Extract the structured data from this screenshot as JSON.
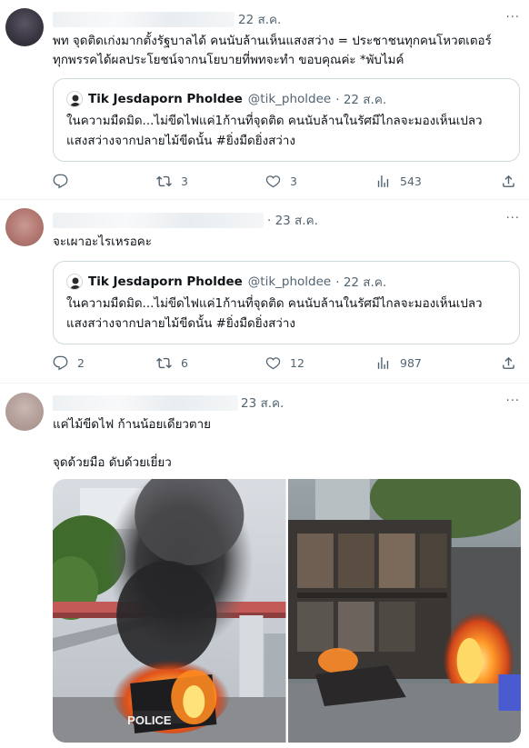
{
  "tweets": [
    {
      "date": "22 ส.ค.",
      "text": "พท จุดติดเก่งมากตั้งรัฐบาลได้ คนนับล้านเห็นแสงสว่าง = ประชาชนทุกคนโหวตเตอร์\nทุกพรรคได้ผลประโยชน์จากนโยบายที่พทจะทำ ขอบคุณค่ะ *พับไมค์",
      "quote": {
        "name": "Tik Jesdaporn Pholdee",
        "handle": "@tik_pholdee",
        "date": "· 22 ส.ค.",
        "text": "ในความมืดมิด...ไม่ขีดไฟแค่1ก้านที่จุดติด คนนับล้านในรัศมีไกลจะมองเห็นเปลว\nแสงสว่างจากปลายไม้ขีดนั้น #ยิ่งมืดยิ่งสว่าง"
      },
      "stats": {
        "replies": "",
        "retweets": "3",
        "likes": "3",
        "views": "543"
      }
    },
    {
      "date": "· 23 ส.ค.",
      "text": "จะเผาอะไรเหรอคะ",
      "quote": {
        "name": "Tik Jesdaporn Pholdee",
        "handle": "@tik_pholdee",
        "date": "· 22 ส.ค.",
        "text": "ในความมืดมิด...ไม่ขีดไฟแค่1ก้านที่จุดติด คนนับล้านในรัศมีไกลจะมองเห็นเปลว\nแสงสว่างจากปลายไม้ขีดนั้น #ยิ่งมืดยิ่งสว่าง"
      },
      "stats": {
        "replies": "2",
        "retweets": "6",
        "likes": "12",
        "views": "987"
      }
    },
    {
      "date": "23 ส.ค.",
      "text": "แค่ไม้ขีดไฟ ก้านน้อยเดียวตาย\n\nจุดด้วยมือ ดับด้วยเยี่ยว",
      "media_caption": "POLICE"
    }
  ],
  "icons": {
    "reply": "reply-icon",
    "retweet": "retweet-icon",
    "like": "heart-icon",
    "views": "views-icon",
    "share": "share-icon",
    "more": "more-icon"
  },
  "more_label": "···"
}
